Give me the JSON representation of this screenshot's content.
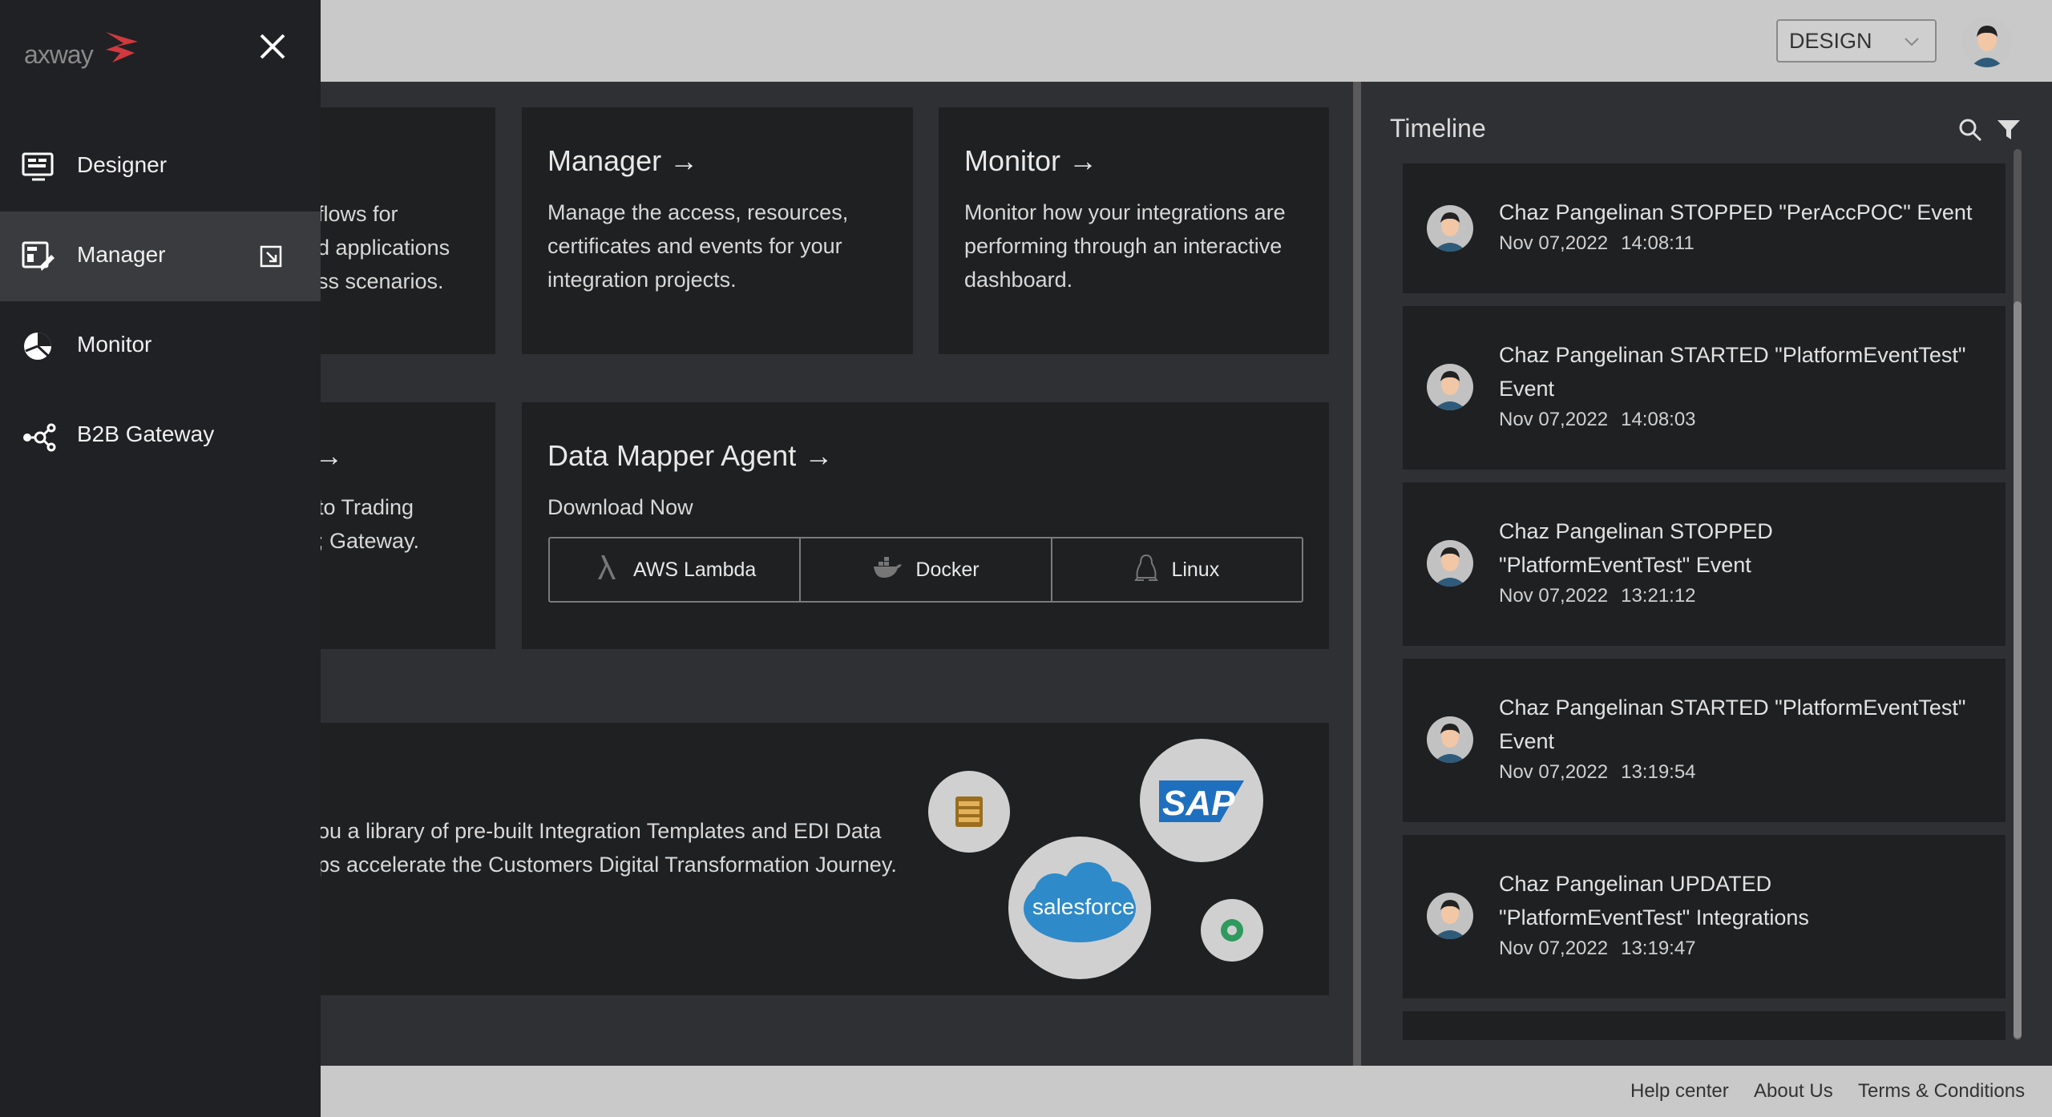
{
  "header": {
    "environment": "DESIGN"
  },
  "cards": {
    "designer_partial": {
      "lines": [
        "flows for",
        "d applications",
        "ss scenarios."
      ]
    },
    "manager": {
      "title": "Manager →",
      "lines": [
        "Manage the access, resources,",
        "certificates and events for your",
        "integration projects."
      ]
    },
    "monitor": {
      "title": "Monitor →",
      "lines": [
        "Monitor how your integrations are",
        "performing through an interactive",
        "dashboard."
      ]
    },
    "b2b_partial": {
      "title": "→",
      "lines": [
        "to Trading",
        "; Gateway."
      ]
    },
    "data_mapper": {
      "title": "Data Mapper Agent →",
      "subtitle": "Download Now",
      "downloads": [
        "AWS Lambda",
        "Docker",
        "Linux"
      ]
    },
    "marketplace_partial": {
      "lines": [
        "ou a library of pre-built Integration Templates and EDI Data",
        "ps accelerate the Customers Digital Transformation Journey."
      ],
      "logos": [
        "salesforce",
        "SAP"
      ]
    }
  },
  "timeline": {
    "title": "Timeline",
    "items": [
      {
        "text": "Chaz Pangelinan STOPPED \"PerAccPOC\" Event",
        "date": "Nov 07,2022",
        "time": "14:08:11"
      },
      {
        "text": "Chaz Pangelinan STARTED \"PlatformEventTest\" Event",
        "date": "Nov 07,2022",
        "time": "14:08:03"
      },
      {
        "text": "Chaz Pangelinan STOPPED \"PlatformEventTest\" Event",
        "date": "Nov 07,2022",
        "time": "13:21:12"
      },
      {
        "text": "Chaz Pangelinan STARTED \"PlatformEventTest\" Event",
        "date": "Nov 07,2022",
        "time": "13:19:54"
      },
      {
        "text": "Chaz Pangelinan UPDATED \"PlatformEventTest\" Integrations",
        "date": "Nov 07,2022",
        "time": "13:19:47"
      }
    ]
  },
  "drawer": {
    "logo_text": "axway",
    "nav": [
      {
        "label": "Designer",
        "icon": "designer-icon",
        "active": false
      },
      {
        "label": "Manager",
        "icon": "manager-icon",
        "active": true
      },
      {
        "label": "Monitor",
        "icon": "monitor-icon",
        "active": false
      },
      {
        "label": "B2B Gateway",
        "icon": "b2b-gateway-icon",
        "active": false
      }
    ]
  },
  "footer": {
    "help": "Help center",
    "about": "About Us",
    "terms": "Terms & Conditions"
  },
  "colors": {
    "drawer_bg": "#202124",
    "active_item": "#3a3b3e",
    "brand_red": "#d0393e"
  }
}
